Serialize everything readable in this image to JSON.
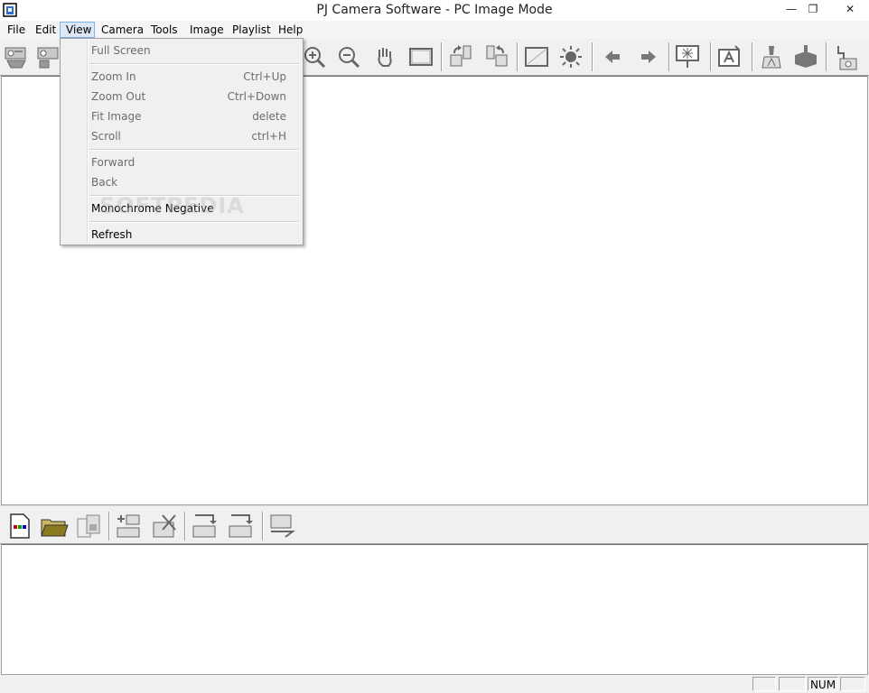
{
  "window": {
    "title": "PJ Camera Software - PC Image Mode",
    "minimize": "—",
    "restore": "❐",
    "close": "✕"
  },
  "menubar": {
    "items": [
      "File",
      "Edit",
      "View",
      "Camera",
      "Tools",
      "Image",
      "Playlist",
      "Help"
    ]
  },
  "view_menu": {
    "items": [
      {
        "label": "Full Screen",
        "shortcut": ""
      },
      {
        "label": "Zoom In",
        "shortcut": "Ctrl+Up"
      },
      {
        "label": "Zoom Out",
        "shortcut": "Ctrl+Down"
      },
      {
        "label": "Fit Image",
        "shortcut": "delete"
      },
      {
        "label": "Scroll",
        "shortcut": "ctrl+H"
      },
      {
        "label": "Forward",
        "shortcut": ""
      },
      {
        "label": "Back",
        "shortcut": ""
      },
      {
        "label": "Monochrome Negative",
        "shortcut": ""
      },
      {
        "label": "Refresh",
        "shortcut": ""
      }
    ]
  },
  "statusbar": {
    "num": "NUM"
  },
  "watermark": "SOFTPEDIA"
}
